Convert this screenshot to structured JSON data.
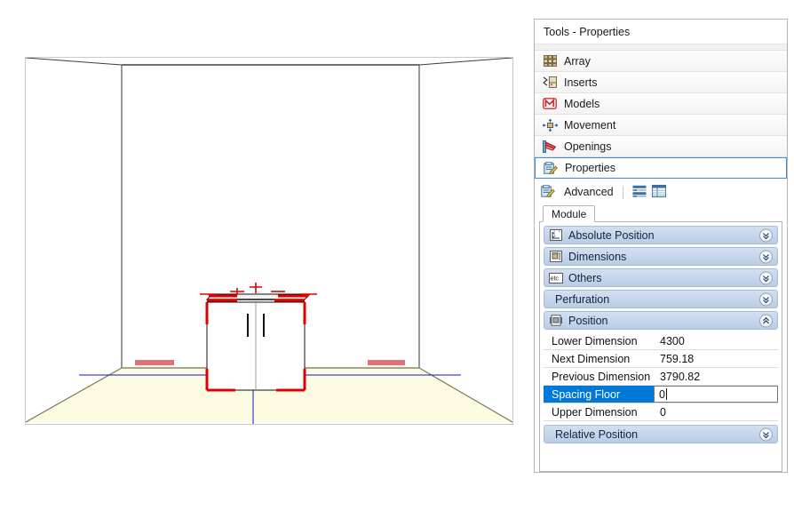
{
  "panel": {
    "title": "Tools - Properties",
    "tools": [
      {
        "label": "Array",
        "icon": "array-icon",
        "selected": false
      },
      {
        "label": "Inserts",
        "icon": "inserts-icon",
        "selected": false
      },
      {
        "label": "Models",
        "icon": "models-icon",
        "selected": false
      },
      {
        "label": "Movement",
        "icon": "movement-icon",
        "selected": false
      },
      {
        "label": "Openings",
        "icon": "openings-icon",
        "selected": false
      },
      {
        "label": "Properties",
        "icon": "properties-icon",
        "selected": true
      }
    ],
    "advanced": {
      "label": "Advanced",
      "icon": "advanced-properties-icon",
      "view_buttons": [
        {
          "name": "categorized-view-button"
        },
        {
          "name": "alphabetical-view-button"
        }
      ]
    },
    "tabs": [
      {
        "label": "Module",
        "active": true
      }
    ],
    "categories": [
      {
        "label": "Absolute Position",
        "icon": "absolute-position-icon",
        "expanded": false
      },
      {
        "label": "Dimensions",
        "icon": "dimensions-icon",
        "expanded": false
      },
      {
        "label": "Others",
        "icon": "etc-icon",
        "expanded": false
      },
      {
        "label": "Perfuration",
        "icon": "",
        "expanded": false
      },
      {
        "label": "Position",
        "icon": "position-icon",
        "expanded": true
      }
    ],
    "position_rows": [
      {
        "name": "Lower Dimension",
        "value": "4300",
        "selected": false,
        "editing": false
      },
      {
        "name": "Next Dimension",
        "value": "759.18",
        "selected": false,
        "editing": false
      },
      {
        "name": "Previous Dimension",
        "value": "3790.82",
        "selected": false,
        "editing": false
      },
      {
        "name": "Spacing Floor",
        "value": "0",
        "selected": true,
        "editing": true
      },
      {
        "name": "Upper Dimension",
        "value": "0",
        "selected": false,
        "editing": false
      }
    ],
    "footer_category": {
      "label": "Relative Position",
      "icon": "",
      "expanded": false
    }
  },
  "viewport": {
    "name": "3d-room-viewport",
    "colors": {
      "wall_line": "#3b3b3b",
      "floor_fill": "#fdfbe2",
      "floor_edge": "#8c8a63",
      "selection": "#e00000",
      "axis": "#1414d2",
      "dimension_text": "#d00000"
    },
    "selected_object": "base-cabinet-module",
    "dimension_labels": [
      {
        "name": "left-dimension-label",
        "text": ""
      },
      {
        "name": "right-dimension-label",
        "text": ""
      }
    ]
  }
}
